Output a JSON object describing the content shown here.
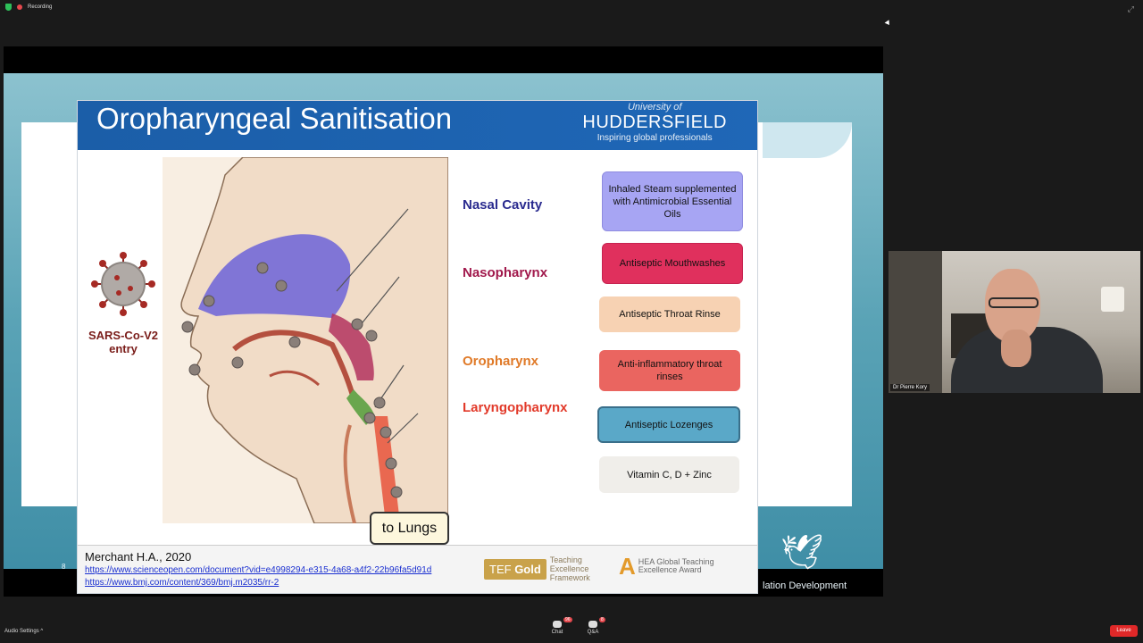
{
  "topbar": {
    "recording": "Recording"
  },
  "slide": {
    "title": "Oropharyngeal Sanitisation",
    "university": {
      "of": "University of",
      "name": "HUDDERSFIELD",
      "tagline": "Inspiring global professionals"
    },
    "virus_label_1": "SARS-Co-V2",
    "virus_label_2": "entry",
    "labels": {
      "nasal": "Nasal Cavity",
      "naso": "Nasopharynx",
      "oro": "Oropharynx",
      "laryngo": "Laryngopharynx"
    },
    "boxes": {
      "b1": "Inhaled Steam supplemented with Antimicrobial Essential Oils",
      "b2": "Antiseptic Mouthwashes",
      "b3": "Antiseptic Throat Rinse",
      "b4": "Anti-inflammatory throat rinses",
      "b5": "Antiseptic Lozenges",
      "b6": "Vitamin C, D + Zinc"
    },
    "to_lungs": "to Lungs",
    "refs": {
      "author": "Merchant H.A., 2020",
      "link1": "https://www.scienceopen.com/document?vid=e4998294-e315-4a68-a4f2-22b96fa5d91d",
      "link2": "https://www.bmj.com/content/369/bmj.m2035/rr-2"
    },
    "tef": {
      "badge_a": "TEF",
      "badge_b": "Gold",
      "text": "Teaching Excellence Framework"
    },
    "hea": {
      "logo": "A",
      "text": "HEA Global Teaching Excellence Award"
    }
  },
  "desktop": {
    "slide_number": "8",
    "footer": "lation Development"
  },
  "video": {
    "name": "Dr Pierre Kory"
  },
  "bottombar": {
    "audio": "Audio Settings ^",
    "chat": "Chat",
    "chat_badge": "96",
    "qa": "Q&A",
    "qa_badge": "8",
    "leave": "Leave"
  },
  "colors": {
    "header_blue": "#1b5ea8",
    "nasal": "#2a2b8f",
    "naso": "#a1194c",
    "oro": "#e07a28",
    "laryngo": "#e23a2a",
    "leave_red": "#e02828"
  }
}
